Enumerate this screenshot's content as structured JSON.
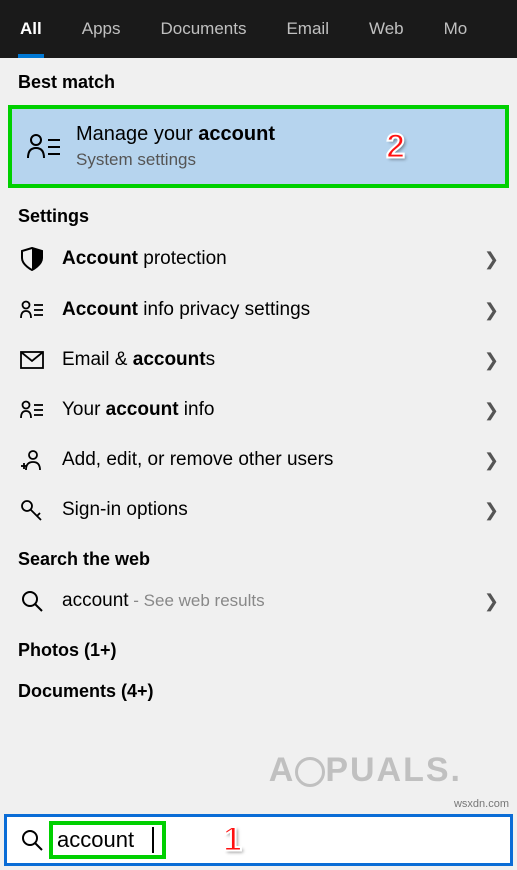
{
  "tabs": {
    "all": "All",
    "apps": "Apps",
    "documents": "Documents",
    "email": "Email",
    "web": "Web",
    "more": "Mo"
  },
  "sections": {
    "best_match": "Best match",
    "settings": "Settings",
    "search_web": "Search the web",
    "photos": "Photos (1+)",
    "documents": "Documents (4+)"
  },
  "best_match": {
    "title_pre": "Manage your ",
    "title_bold": "account",
    "subtitle": "System settings"
  },
  "settings_results": [
    {
      "icon": "shield",
      "pre": "",
      "bold": "Account",
      "post": " protection"
    },
    {
      "icon": "person-list",
      "pre": "",
      "bold": "Account",
      "post": " info privacy settings"
    },
    {
      "icon": "mail",
      "pre": "Email & ",
      "bold": "account",
      "post": "s"
    },
    {
      "icon": "person-list",
      "pre": "Your ",
      "bold": "account",
      "post": " info"
    },
    {
      "icon": "person-plus",
      "pre": "Add, edit, or remove other users",
      "bold": "",
      "post": ""
    },
    {
      "icon": "key",
      "pre": "Sign-in options",
      "bold": "",
      "post": ""
    }
  ],
  "web_result": {
    "query": "account",
    "suffix": " - See web results"
  },
  "search": {
    "value": "account"
  },
  "callouts": {
    "one": "1",
    "two": "2"
  },
  "watermark": "A  PUALS",
  "source": "wsxdn.com"
}
